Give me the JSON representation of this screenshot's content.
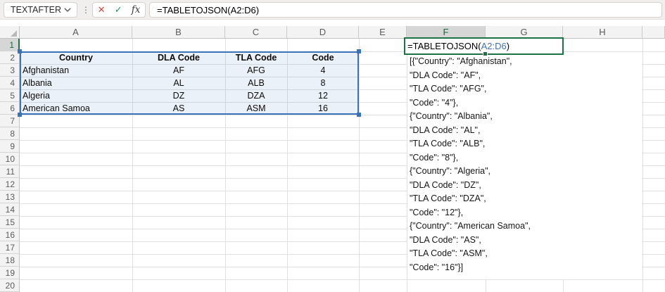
{
  "formula_bar": {
    "name_box": "TEXTAFTER",
    "cancel_icon": "✕",
    "enter_icon": "✓",
    "fx_icon": "fx",
    "formula": "=TABLETOJSON(A2:D6)"
  },
  "active_cell": {
    "reference": "F1",
    "formula_prefix": "=TABLETOJSON(",
    "formula_range_ref": "A2:D6",
    "formula_suffix": ")"
  },
  "grid": {
    "column_letters": [
      "A",
      "B",
      "C",
      "D",
      "E",
      "F",
      "G",
      "H"
    ],
    "row_numbers": [
      1,
      2,
      3,
      4,
      5,
      6,
      7,
      8,
      9,
      10,
      11,
      12,
      13,
      14,
      15,
      16,
      17,
      18,
      19,
      20
    ],
    "selected_column_letter": "F",
    "selected_row_number": 1,
    "highlighted_range": "A2:D6"
  },
  "table": {
    "headers": [
      "Country",
      "DLA Code",
      "TLA Code",
      "Code"
    ],
    "rows": [
      [
        "Afghanistan",
        "AF",
        "AFG",
        "4"
      ],
      [
        "Albania",
        "AL",
        "ALB",
        "8"
      ],
      [
        "Algeria",
        "DZ",
        "DZA",
        "12"
      ],
      [
        "American Samoa",
        "AS",
        "ASM",
        "16"
      ]
    ]
  },
  "json_output_lines": [
    "[{\"Country\": \"Afghanistan\",",
    "\"DLA Code\": \"AF\",",
    "\"TLA Code\": \"AFG\",",
    "\"Code\": \"4\"},",
    "{\"Country\": \"Albania\",",
    "\"DLA Code\": \"AL\",",
    "\"TLA Code\": \"ALB\",",
    "\"Code\": \"8\"},",
    "{\"Country\": \"Algeria\",",
    "\"DLA Code\": \"DZ\",",
    "\"TLA Code\": \"DZA\",",
    "\"Code\": \"12\"},",
    "{\"Country\": \"American Samoa\",",
    "\"DLA Code\": \"AS\",",
    "\"TLA Code\": \"ASM\",",
    "\"Code\": \"16\"}]"
  ],
  "colors": {
    "selection_green": "#1e7145",
    "selection_green_text": "#0e6b3b",
    "reference_blue": "#3b72b8",
    "reference_text_blue": "#3f72ba",
    "range_fill": "rgba(59,114,184,0.10)"
  }
}
